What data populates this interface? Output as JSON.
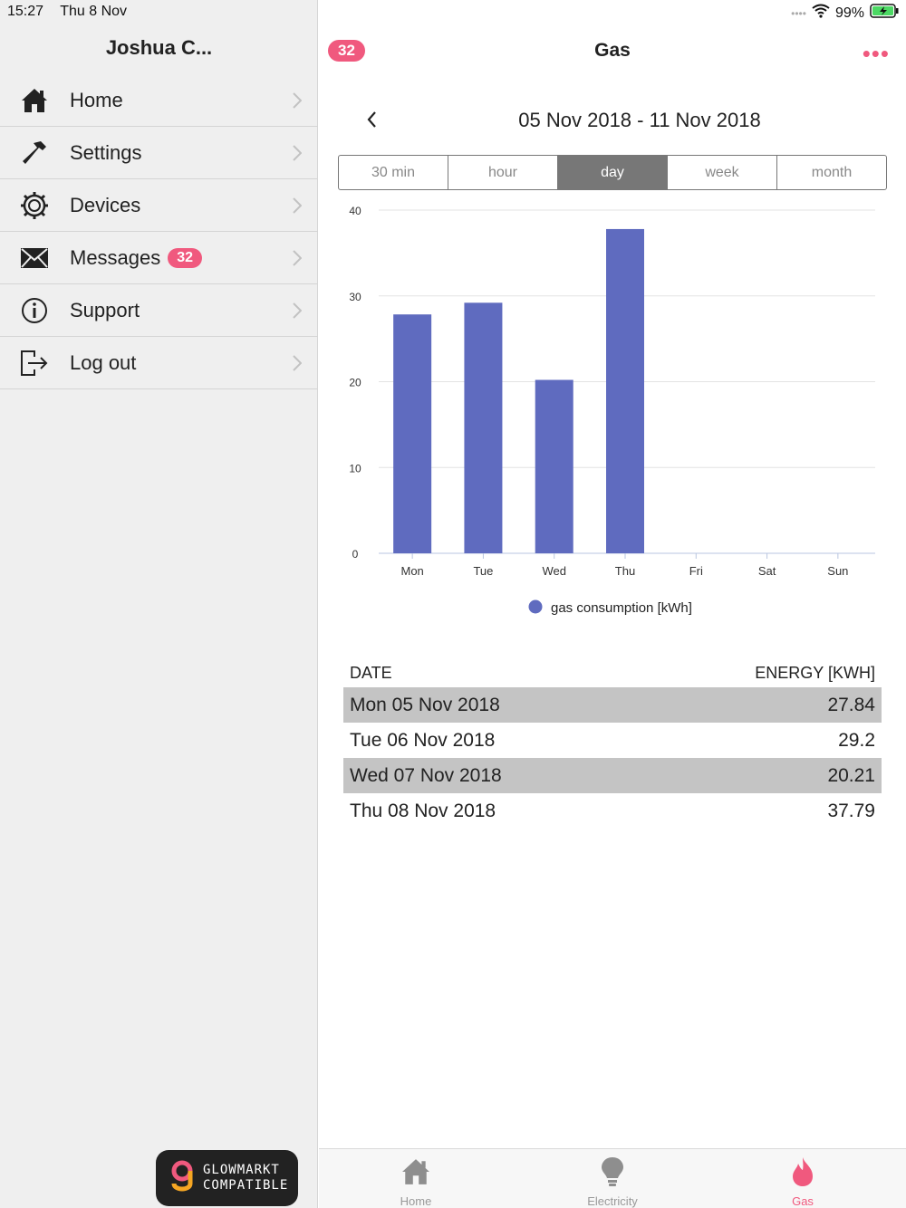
{
  "status": {
    "time": "15:27",
    "date": "Thu 8 Nov",
    "battery": "99%"
  },
  "sidebar": {
    "user_name": "Joshua C...",
    "items": [
      {
        "label": "Home",
        "icon": "home-icon"
      },
      {
        "label": "Settings",
        "icon": "hammer-icon"
      },
      {
        "label": "Devices",
        "icon": "gear-icon"
      },
      {
        "label": "Messages",
        "icon": "envelope-icon",
        "badge": "32"
      },
      {
        "label": "Support",
        "icon": "info-icon"
      },
      {
        "label": "Log out",
        "icon": "logout-icon"
      }
    ],
    "brand": {
      "line1": "GLOWMARKT",
      "line2": "COMPATIBLE"
    }
  },
  "header": {
    "badge": "32",
    "title": "Gas",
    "more": "•••"
  },
  "period": {
    "range": "05 Nov 2018 - 11 Nov 2018",
    "segments": [
      "30 min",
      "hour",
      "day",
      "week",
      "month"
    ],
    "active_segment": "day"
  },
  "chart_data": {
    "type": "bar",
    "categories": [
      "Mon",
      "Tue",
      "Wed",
      "Thu",
      "Fri",
      "Sat",
      "Sun"
    ],
    "series": [
      {
        "name": "gas consumption [kWh]",
        "values": [
          27.84,
          29.2,
          20.21,
          37.79,
          null,
          null,
          null
        ],
        "color": "#5f6bbf"
      }
    ],
    "ylim": [
      0,
      40
    ],
    "yticks": [
      0,
      10,
      20,
      30,
      40
    ],
    "grid": true,
    "legend": "bottom"
  },
  "table": {
    "headers": {
      "date": "DATE",
      "energy": "ENERGY [KWH]"
    },
    "rows": [
      {
        "date": "Mon 05 Nov 2018",
        "energy": "27.84"
      },
      {
        "date": "Tue 06 Nov 2018",
        "energy": "29.2"
      },
      {
        "date": "Wed 07 Nov 2018",
        "energy": "20.21"
      },
      {
        "date": "Thu 08 Nov 2018",
        "energy": "37.79"
      }
    ]
  },
  "tabbar": {
    "tabs": [
      {
        "label": "Home",
        "icon": "home-icon"
      },
      {
        "label": "Electricity",
        "icon": "lightbulb-icon"
      },
      {
        "label": "Gas",
        "icon": "flame-icon",
        "active": true
      }
    ]
  },
  "colors": {
    "accent": "#f0597e",
    "bar": "#5f6bbf",
    "segment_active": "#777777"
  }
}
